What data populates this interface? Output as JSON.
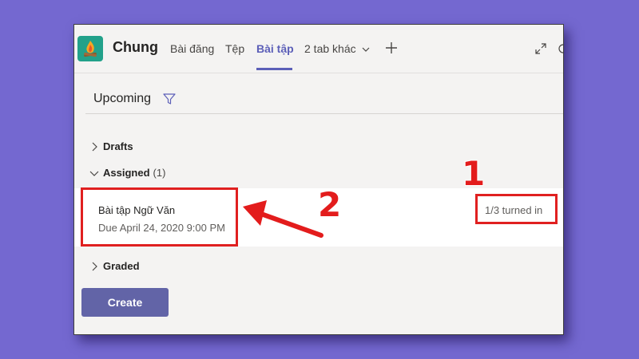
{
  "header": {
    "channel_name": "Chung",
    "tabs": [
      {
        "label": "Bài đăng",
        "active": false
      },
      {
        "label": "Tệp",
        "active": false
      },
      {
        "label": "Bài tập",
        "active": true
      },
      {
        "label": "2 tab khác",
        "active": false
      }
    ]
  },
  "main": {
    "section_title": "Upcoming",
    "groups": {
      "drafts": {
        "label": "Drafts"
      },
      "assigned": {
        "label": "Assigned",
        "count": "(1)"
      },
      "graded": {
        "label": "Graded"
      }
    },
    "assignment": {
      "title": "Bài tập Ngữ Văn",
      "due": "Due April 24, 2020 9:00 PM",
      "status": "1/3 turned in"
    },
    "create_label": "Create"
  },
  "annotations": {
    "label_1": "1",
    "label_2": "2"
  },
  "colors": {
    "accent": "#6264a7",
    "background": "#7468d0",
    "annotation": "#e02020",
    "app_icon": "#22a18a"
  },
  "icons": [
    "campfire-icon",
    "chevron-down-icon",
    "plus-icon",
    "expand-icon",
    "refresh-icon",
    "filter-icon",
    "chevron-right-icon"
  ]
}
